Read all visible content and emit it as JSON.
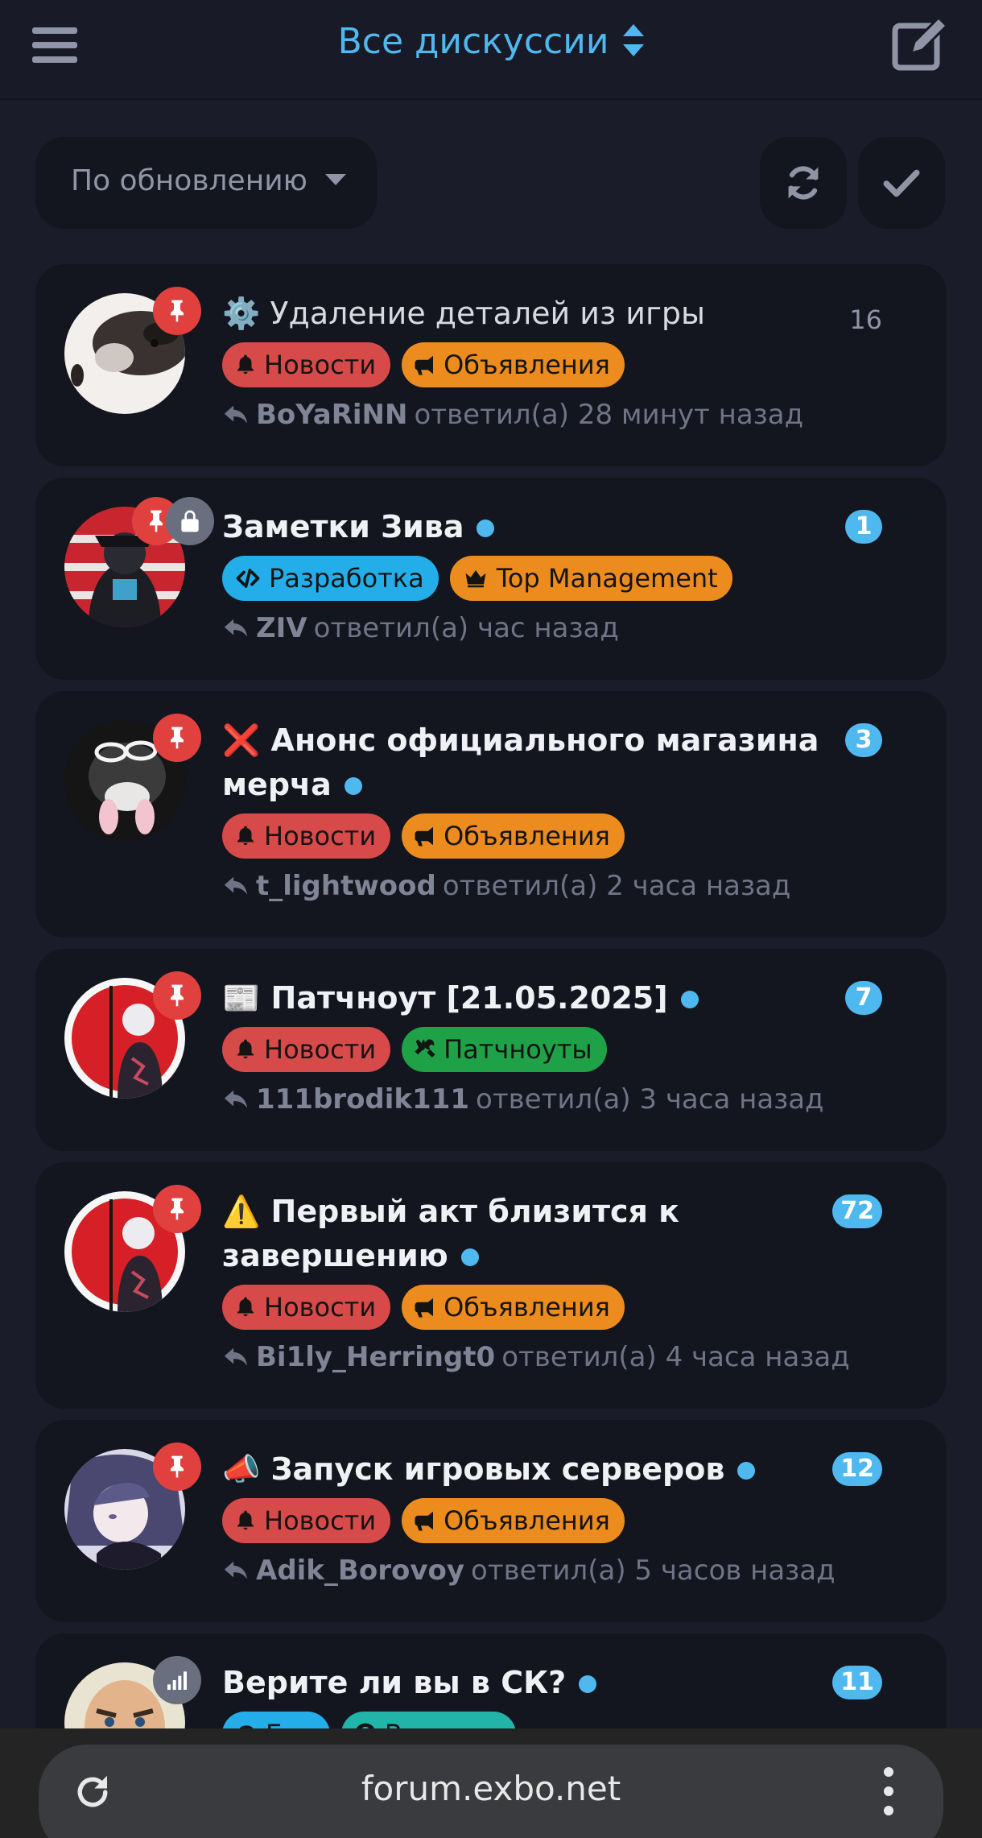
{
  "header": {
    "title": "Все дискуссии"
  },
  "toolbar": {
    "sort_label": "По обновлению"
  },
  "discussions": [
    {
      "title": "⚙️ Удаление деталей из игры",
      "count": "16",
      "tags": [
        {
          "label": "Новости",
          "icon": "bell-icon",
          "color": "#d64a4a"
        },
        {
          "label": "Объявления",
          "icon": "bullhorn-icon",
          "color": "#ed8c1e"
        }
      ],
      "reply_user": "BoYaRiNN",
      "reply_text": "ответил(а) 28 минут назад"
    },
    {
      "title": "Заметки Зива",
      "count": "1",
      "tags": [
        {
          "label": "Разработка",
          "icon": "code-icon",
          "color": "#24aee9"
        },
        {
          "label": "Top Management",
          "icon": "crown-icon",
          "color": "#ed8c1e"
        }
      ],
      "reply_user": "ZIV",
      "reply_text": "ответил(а) час назад"
    },
    {
      "title": "❌ Анонс официального магазина мерча",
      "count": "3",
      "tags": [
        {
          "label": "Новости",
          "icon": "bell-icon",
          "color": "#d64a4a"
        },
        {
          "label": "Объявления",
          "icon": "bullhorn-icon",
          "color": "#ed8c1e"
        }
      ],
      "reply_user": "t_lightwood",
      "reply_text": "ответил(а) 2 часа назад"
    },
    {
      "title": "📰 Патчноут [21.05.2025]",
      "count": "7",
      "tags": [
        {
          "label": "Новости",
          "icon": "bell-icon",
          "color": "#d64a4a"
        },
        {
          "label": "Патчноуты",
          "icon": "tools-icon",
          "color": "#1fa247"
        }
      ],
      "reply_user": "111brodik111",
      "reply_text": "ответил(а) 3 часа назад"
    },
    {
      "title": "⚠️ Первый акт близится к завершению",
      "count": "72",
      "tags": [
        {
          "label": "Новости",
          "icon": "bell-icon",
          "color": "#d64a4a"
        },
        {
          "label": "Объявления",
          "icon": "bullhorn-icon",
          "color": "#ed8c1e"
        }
      ],
      "reply_user": "Bi1ly_Herringt0",
      "reply_text": "ответил(а) 4 часа назад"
    },
    {
      "title": "📣 Запуск игровых серверов",
      "count": "12",
      "tags": [
        {
          "label": "Новости",
          "icon": "bell-icon",
          "color": "#d64a4a"
        },
        {
          "label": "Объявления",
          "icon": "bullhorn-icon",
          "color": "#ed8c1e"
        }
      ],
      "reply_user": "Adik_Borovoy",
      "reply_text": "ответил(а) 5 часов назад"
    },
    {
      "title": "Верите ли вы в СК?",
      "count": "11",
      "tags": [
        {
          "label": "Бар",
          "icon": "radiation-icon",
          "color": "#24aee9"
        },
        {
          "label": "Вопросы",
          "icon": "question-circle-icon",
          "color": "#22b3a9"
        }
      ]
    }
  ],
  "browser": {
    "url": "forum.exbo.net"
  },
  "colors": {
    "accent": "#4fb8ef",
    "background": "#1a1d29",
    "card": "#13151f",
    "pin": "#e0413f"
  }
}
